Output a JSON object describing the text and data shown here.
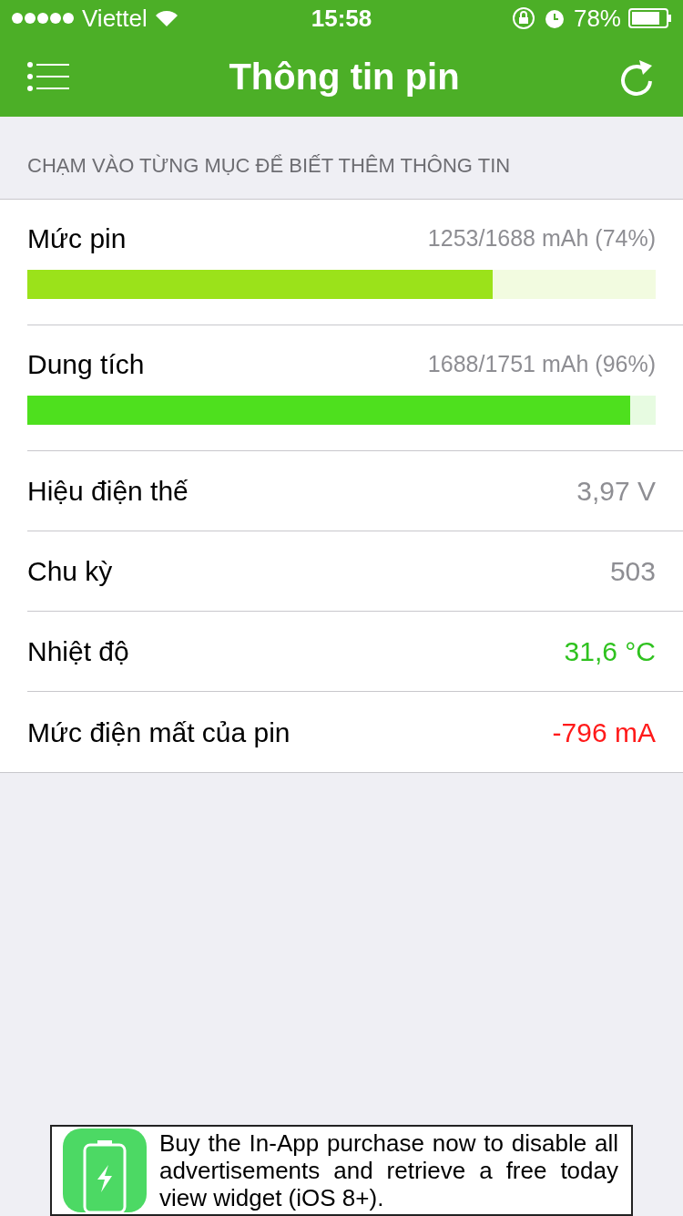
{
  "status_bar": {
    "carrier": "Viettel",
    "time": "15:58",
    "battery": "78%"
  },
  "nav": {
    "title": "Thông tin pin"
  },
  "section_header": "CHẠM VÀO TỪNG MỤC ĐỂ BIẾT THÊM THÔNG TIN",
  "rows": [
    {
      "kind": "meter",
      "label": "Mức pin",
      "value": "1253/1688 mAh (74%)",
      "level": 0.74,
      "color": "#9be21a"
    },
    {
      "kind": "meter",
      "label": "Dung tích",
      "value": "1688/1751 mAh (96%)",
      "level": 0.96,
      "color": "#4ee01e"
    },
    {
      "kind": "plain",
      "label": "Hiệu điện thế",
      "value": "3,97 V",
      "color": "#8e8e93"
    },
    {
      "kind": "plain",
      "label": "Chu kỳ",
      "value": "503",
      "color": "#8e8e93"
    },
    {
      "kind": "plain",
      "label": "Nhiệt độ",
      "value": "31,6 °C",
      "color": "#2fc21f"
    },
    {
      "kind": "plain",
      "label": "Mức điện mất của pin",
      "value": "-796 mA",
      "color": "#ff1a1a"
    }
  ],
  "ad": {
    "text": "Buy the In-App purchase now to disable all advertisements and retrieve a free today view widget (iOS 8+)."
  }
}
